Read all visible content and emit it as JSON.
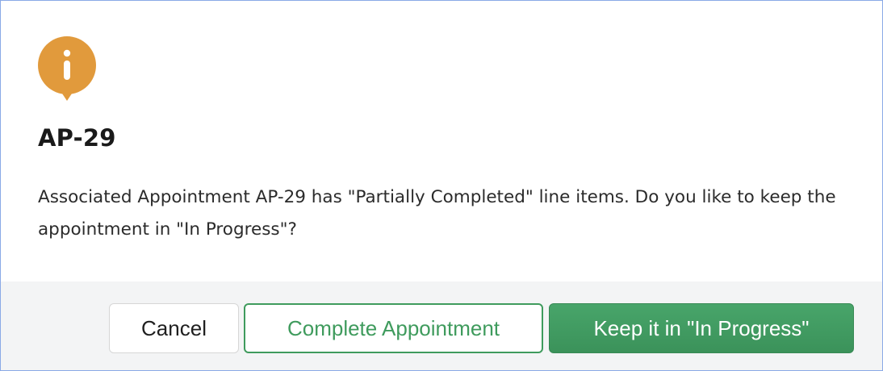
{
  "dialog": {
    "icon": "info-icon",
    "icon_color": "#e19a3c",
    "title": "AP-29",
    "message": "Associated Appointment AP-29 has \"Partially Completed\" line items. Do you like to keep the appointment in \"In Progress\"?"
  },
  "footer": {
    "cancel_label": "Cancel",
    "complete_label": "Complete Appointment",
    "keep_label": "Keep it in \"In Progress\""
  },
  "colors": {
    "primary_green": "#3f9b5d",
    "footer_background": "#f3f4f5",
    "dialog_border": "#8aa9e6"
  }
}
